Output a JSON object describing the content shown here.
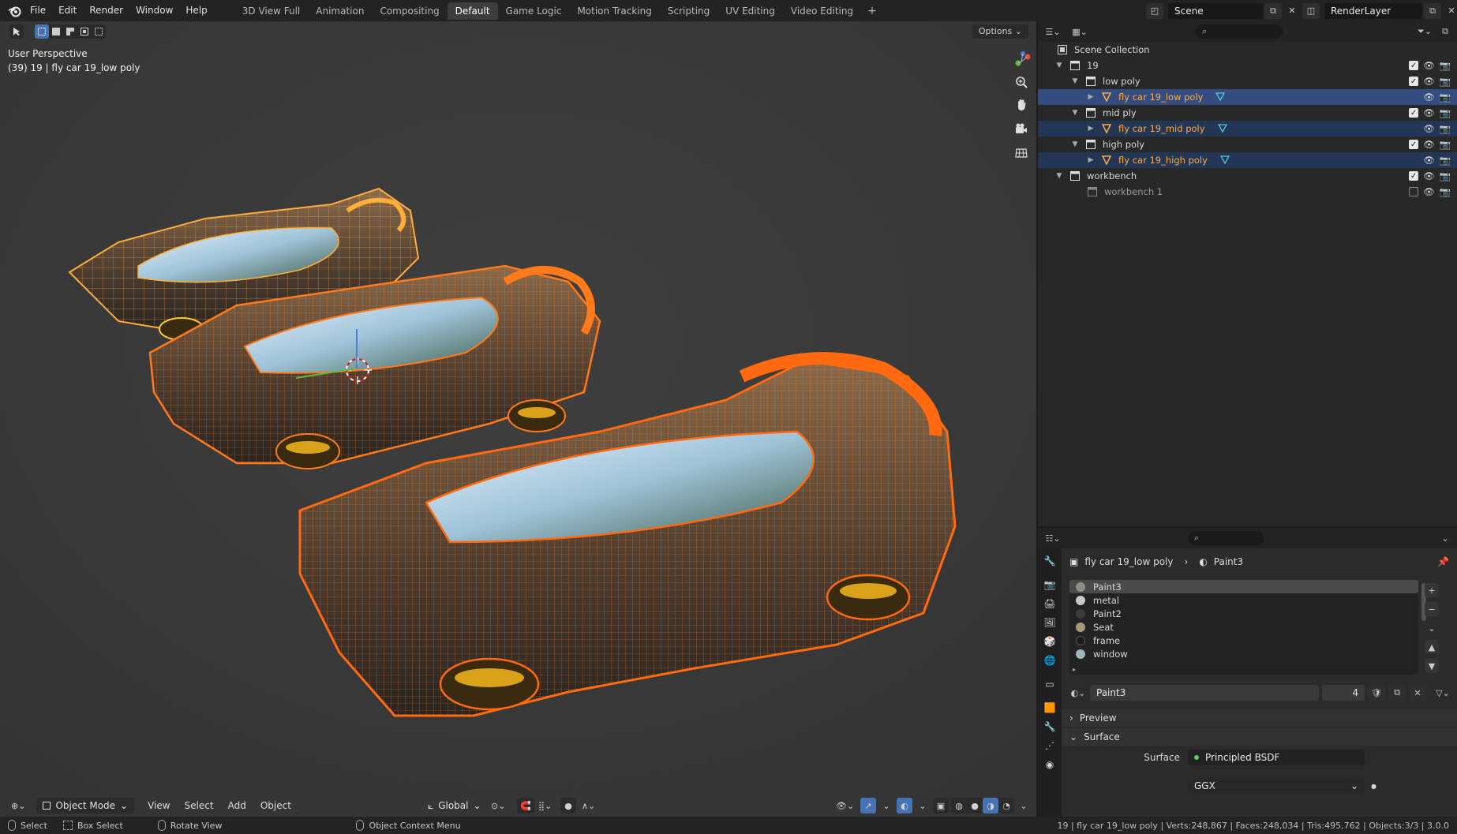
{
  "topbar": {
    "menus": [
      "File",
      "Edit",
      "Render",
      "Window",
      "Help"
    ],
    "workspaces": [
      "3D View Full",
      "Animation",
      "Compositing",
      "Default",
      "Game Logic",
      "Motion Tracking",
      "Scripting",
      "UV Editing",
      "Video Editing"
    ],
    "active_workspace": "Default",
    "add_tab": "+",
    "scene": "Scene",
    "render_layer": "RenderLayer"
  },
  "viewport": {
    "perspective": "User Perspective",
    "object_info": "(39) 19 | fly car 19_low poly",
    "options_label": "Options",
    "footer": {
      "mode": "Object Mode",
      "menus": [
        "View",
        "Select",
        "Add",
        "Object"
      ],
      "orientation": "Global"
    }
  },
  "outliner": {
    "root": "Scene Collection",
    "rows": [
      {
        "label": "19",
        "kind": "collection",
        "depth": 1,
        "expanded": true,
        "checked": true
      },
      {
        "label": "low poly",
        "kind": "collection",
        "depth": 2,
        "expanded": true,
        "checked": true
      },
      {
        "label": "fly car 19_low poly",
        "kind": "object",
        "depth": 3,
        "selected": "active"
      },
      {
        "label": "mid ply",
        "kind": "collection",
        "depth": 2,
        "expanded": true,
        "checked": true
      },
      {
        "label": "fly car 19_mid poly",
        "kind": "object",
        "depth": 3,
        "selected": "yes"
      },
      {
        "label": "high poly",
        "kind": "collection",
        "depth": 2,
        "expanded": true,
        "checked": true
      },
      {
        "label": "fly car 19_high poly",
        "kind": "object",
        "depth": 3,
        "selected": "yes"
      },
      {
        "label": "workbench",
        "kind": "collection",
        "depth": 1,
        "expanded": true,
        "checked": true
      },
      {
        "label": "workbench 1",
        "kind": "collection-dim",
        "depth": 2,
        "checked": false
      }
    ]
  },
  "properties": {
    "breadcrumb_object": "fly car 19_low poly",
    "breadcrumb_material": "Paint3",
    "materials": [
      {
        "name": "Paint3",
        "color": "#8a8f86",
        "active": true
      },
      {
        "name": "metal",
        "color": "#c9c9c9",
        "active": false
      },
      {
        "name": "Paint2",
        "color": "#3b3b3b",
        "active": false
      },
      {
        "name": "Seat",
        "color": "#a89a78",
        "active": false
      },
      {
        "name": "frame",
        "color": "#1b1b1b",
        "active": false
      },
      {
        "name": "window",
        "color": "#9fb5b8",
        "active": false
      }
    ],
    "slot_material": "Paint3",
    "slot_users": "4",
    "preview_label": "Preview",
    "surface_label": "Surface",
    "surface_field_label": "Surface",
    "surface_shader": "Principled BSDF",
    "distribution": "GGX"
  },
  "statusbar": {
    "select": "Select",
    "box_select": "Box Select",
    "rotate_view": "Rotate View",
    "context_menu": "Object Context Menu",
    "stats": "19 | fly car 19_low poly | Verts:248,867 | Faces:248,034 | Tris:495,762 | Objects:3/3 | 3.0.0"
  },
  "colors": {
    "selection_blue": "#334d80",
    "object_orange": "#ffaa40",
    "wire_orange": "#ff7a1a",
    "viewport_bg": "#393939"
  }
}
